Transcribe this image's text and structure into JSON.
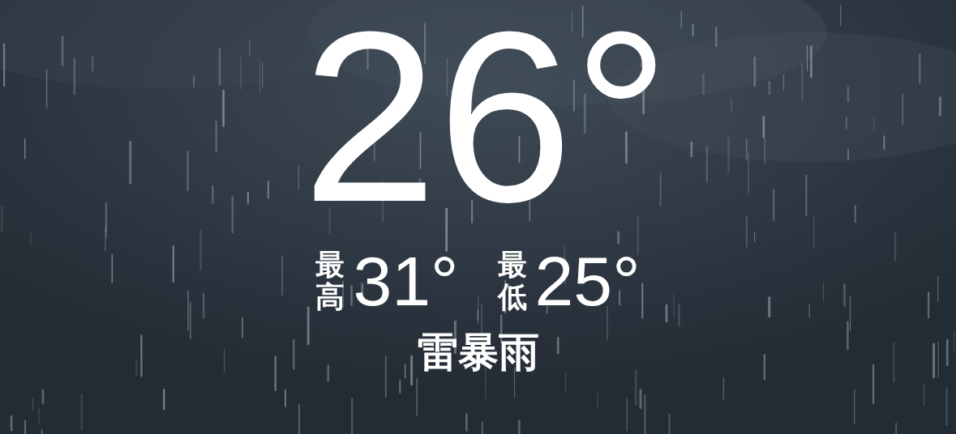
{
  "current": {
    "temperature": "26°"
  },
  "high": {
    "label": "最高",
    "value": "31°"
  },
  "low": {
    "label": "最低",
    "value": "25°"
  },
  "condition": "雷暴雨"
}
